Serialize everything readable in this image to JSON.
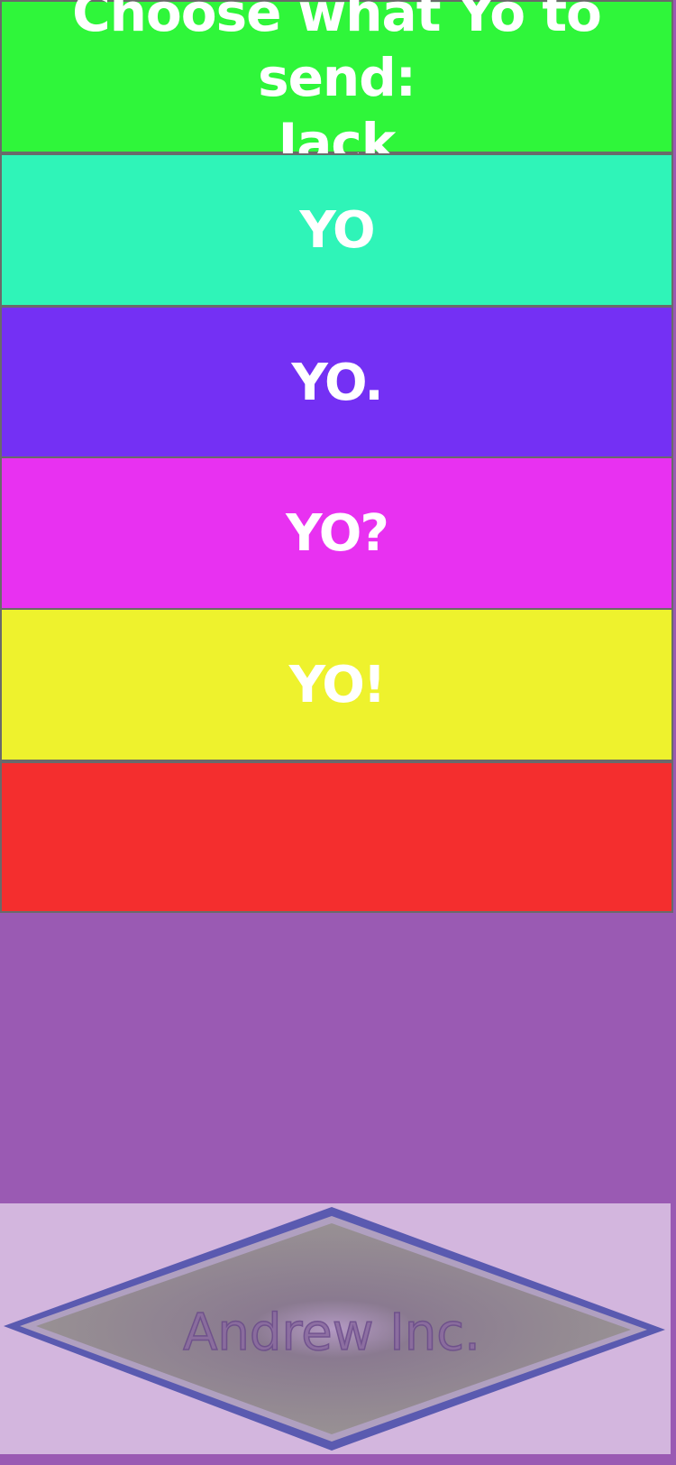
{
  "header": {
    "title_line1": "Choose what Yo to send:",
    "title_line2": "Jack",
    "color": "#2ff63a"
  },
  "options": [
    {
      "label": "YO",
      "color": "#2ff4b8"
    },
    {
      "label": "YO.",
      "color": "#7430f4"
    },
    {
      "label": "YO?",
      "color": "#e831f1"
    },
    {
      "label": "YO!",
      "color": "#eef22d"
    },
    {
      "label": "",
      "color": "#f42e2e"
    }
  ],
  "background_color": "#9a5ab3",
  "logo": {
    "text": "Andrew Inc.",
    "panel_color": "#d3b6de",
    "border_color": "#6060b0",
    "icon": "diamond-logo"
  }
}
